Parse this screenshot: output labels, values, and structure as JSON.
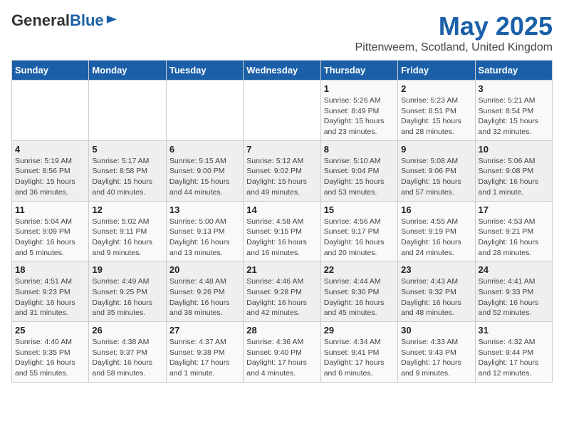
{
  "header": {
    "logo_general": "General",
    "logo_blue": "Blue",
    "title": "May 2025",
    "subtitle": "Pittenweem, Scotland, United Kingdom"
  },
  "weekdays": [
    "Sunday",
    "Monday",
    "Tuesday",
    "Wednesday",
    "Thursday",
    "Friday",
    "Saturday"
  ],
  "weeks": [
    [
      {
        "day": "",
        "info": ""
      },
      {
        "day": "",
        "info": ""
      },
      {
        "day": "",
        "info": ""
      },
      {
        "day": "",
        "info": ""
      },
      {
        "day": "1",
        "info": "Sunrise: 5:26 AM\nSunset: 8:49 PM\nDaylight: 15 hours\nand 23 minutes."
      },
      {
        "day": "2",
        "info": "Sunrise: 5:23 AM\nSunset: 8:51 PM\nDaylight: 15 hours\nand 28 minutes."
      },
      {
        "day": "3",
        "info": "Sunrise: 5:21 AM\nSunset: 8:54 PM\nDaylight: 15 hours\nand 32 minutes."
      }
    ],
    [
      {
        "day": "4",
        "info": "Sunrise: 5:19 AM\nSunset: 8:56 PM\nDaylight: 15 hours\nand 36 minutes."
      },
      {
        "day": "5",
        "info": "Sunrise: 5:17 AM\nSunset: 8:58 PM\nDaylight: 15 hours\nand 40 minutes."
      },
      {
        "day": "6",
        "info": "Sunrise: 5:15 AM\nSunset: 9:00 PM\nDaylight: 15 hours\nand 44 minutes."
      },
      {
        "day": "7",
        "info": "Sunrise: 5:12 AM\nSunset: 9:02 PM\nDaylight: 15 hours\nand 49 minutes."
      },
      {
        "day": "8",
        "info": "Sunrise: 5:10 AM\nSunset: 9:04 PM\nDaylight: 15 hours\nand 53 minutes."
      },
      {
        "day": "9",
        "info": "Sunrise: 5:08 AM\nSunset: 9:06 PM\nDaylight: 15 hours\nand 57 minutes."
      },
      {
        "day": "10",
        "info": "Sunrise: 5:06 AM\nSunset: 9:08 PM\nDaylight: 16 hours\nand 1 minute."
      }
    ],
    [
      {
        "day": "11",
        "info": "Sunrise: 5:04 AM\nSunset: 9:09 PM\nDaylight: 16 hours\nand 5 minutes."
      },
      {
        "day": "12",
        "info": "Sunrise: 5:02 AM\nSunset: 9:11 PM\nDaylight: 16 hours\nand 9 minutes."
      },
      {
        "day": "13",
        "info": "Sunrise: 5:00 AM\nSunset: 9:13 PM\nDaylight: 16 hours\nand 13 minutes."
      },
      {
        "day": "14",
        "info": "Sunrise: 4:58 AM\nSunset: 9:15 PM\nDaylight: 16 hours\nand 16 minutes."
      },
      {
        "day": "15",
        "info": "Sunrise: 4:56 AM\nSunset: 9:17 PM\nDaylight: 16 hours\nand 20 minutes."
      },
      {
        "day": "16",
        "info": "Sunrise: 4:55 AM\nSunset: 9:19 PM\nDaylight: 16 hours\nand 24 minutes."
      },
      {
        "day": "17",
        "info": "Sunrise: 4:53 AM\nSunset: 9:21 PM\nDaylight: 16 hours\nand 28 minutes."
      }
    ],
    [
      {
        "day": "18",
        "info": "Sunrise: 4:51 AM\nSunset: 9:23 PM\nDaylight: 16 hours\nand 31 minutes."
      },
      {
        "day": "19",
        "info": "Sunrise: 4:49 AM\nSunset: 9:25 PM\nDaylight: 16 hours\nand 35 minutes."
      },
      {
        "day": "20",
        "info": "Sunrise: 4:48 AM\nSunset: 9:26 PM\nDaylight: 16 hours\nand 38 minutes."
      },
      {
        "day": "21",
        "info": "Sunrise: 4:46 AM\nSunset: 9:28 PM\nDaylight: 16 hours\nand 42 minutes."
      },
      {
        "day": "22",
        "info": "Sunrise: 4:44 AM\nSunset: 9:30 PM\nDaylight: 16 hours\nand 45 minutes."
      },
      {
        "day": "23",
        "info": "Sunrise: 4:43 AM\nSunset: 9:32 PM\nDaylight: 16 hours\nand 48 minutes."
      },
      {
        "day": "24",
        "info": "Sunrise: 4:41 AM\nSunset: 9:33 PM\nDaylight: 16 hours\nand 52 minutes."
      }
    ],
    [
      {
        "day": "25",
        "info": "Sunrise: 4:40 AM\nSunset: 9:35 PM\nDaylight: 16 hours\nand 55 minutes."
      },
      {
        "day": "26",
        "info": "Sunrise: 4:38 AM\nSunset: 9:37 PM\nDaylight: 16 hours\nand 58 minutes."
      },
      {
        "day": "27",
        "info": "Sunrise: 4:37 AM\nSunset: 9:38 PM\nDaylight: 17 hours\nand 1 minute."
      },
      {
        "day": "28",
        "info": "Sunrise: 4:36 AM\nSunset: 9:40 PM\nDaylight: 17 hours\nand 4 minutes."
      },
      {
        "day": "29",
        "info": "Sunrise: 4:34 AM\nSunset: 9:41 PM\nDaylight: 17 hours\nand 6 minutes."
      },
      {
        "day": "30",
        "info": "Sunrise: 4:33 AM\nSunset: 9:43 PM\nDaylight: 17 hours\nand 9 minutes."
      },
      {
        "day": "31",
        "info": "Sunrise: 4:32 AM\nSunset: 9:44 PM\nDaylight: 17 hours\nand 12 minutes."
      }
    ]
  ]
}
